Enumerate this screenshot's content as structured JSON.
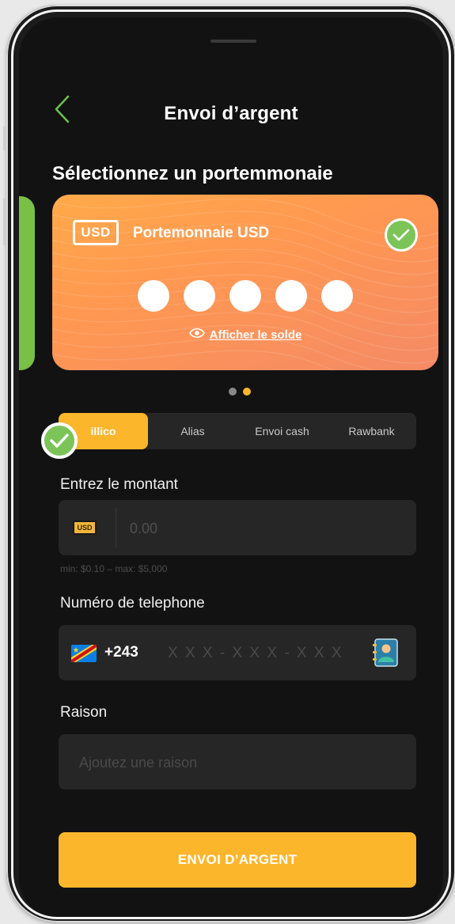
{
  "header": {
    "title": "Envoi d’argent",
    "back_icon": "chevron-left-icon"
  },
  "wallet_section": {
    "title": "Sélectionnez un portemmonaie",
    "card": {
      "currency_badge": "USD",
      "name": "Portemonnaie USD",
      "selected": true,
      "hidden_balance_dots": 5,
      "show_balance_label": "Afficher le solde",
      "colors": [
        "#ffaa4a",
        "#f58a66"
      ]
    },
    "pager": {
      "count": 2,
      "active_index": 1,
      "active_color": "#fbb62c",
      "inactive_color": "#888888"
    }
  },
  "tabs": {
    "items": [
      "illico",
      "Alias",
      "Envoi cash",
      "Rawbank"
    ],
    "active_index": 0
  },
  "amount": {
    "label": "Entrez le montant",
    "currency_badge": "USD",
    "placeholder": "0.00",
    "limits": "min: $0.10 – max: $5,000"
  },
  "phone": {
    "label": "Numéro de telephone",
    "dial_code": "+243",
    "placeholder": "X X X - X X X - X X X",
    "contact_icon": "contact-book-icon"
  },
  "reason": {
    "label": "Raison",
    "placeholder": "Ajoutez une raison"
  },
  "submit": {
    "label": "ENVOI D’ARGENT"
  },
  "colors": {
    "accent": "#fbb62c",
    "success": "#7cc458",
    "background": "#121212",
    "field": "#262626"
  }
}
